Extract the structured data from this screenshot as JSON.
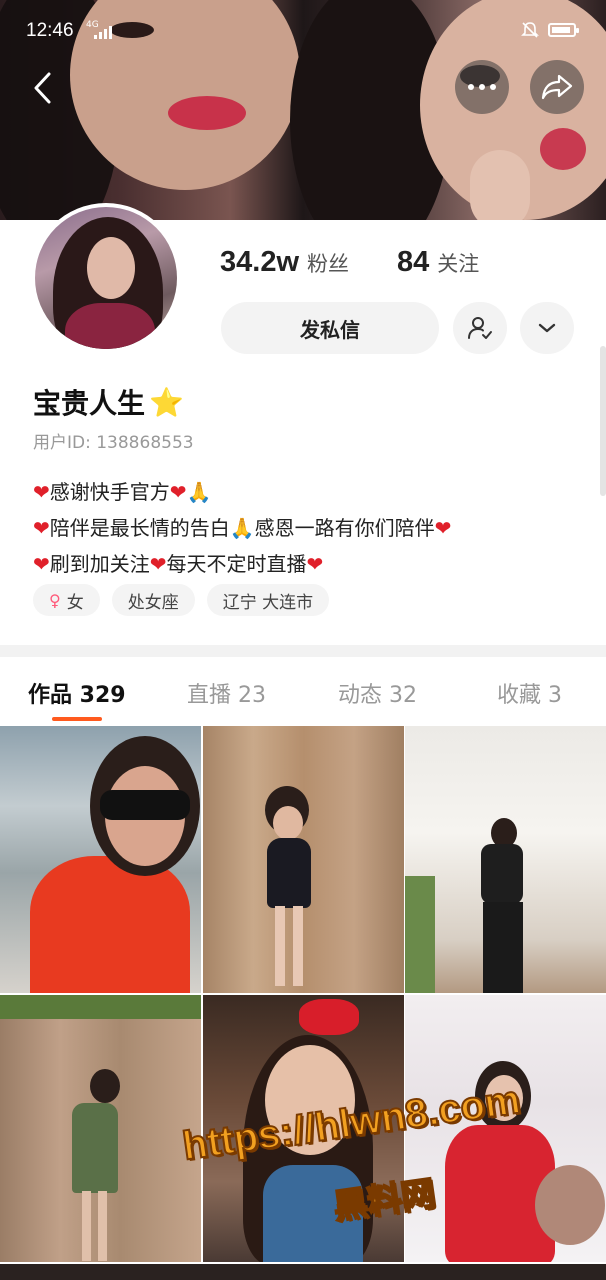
{
  "status_bar": {
    "time": "12:46",
    "network": "4G",
    "battery_level": 0.7
  },
  "header": {
    "back_icon": "chevron-left-icon",
    "more_icon": "more-dots-icon",
    "share_icon": "share-arrow-icon"
  },
  "profile": {
    "followers_count": "34.2w",
    "followers_label": "粉丝",
    "following_count": "84",
    "following_label": "关注",
    "message_button": "发私信",
    "name": "宝贵人生",
    "name_badge": "⭐",
    "user_id": "用户ID: 138868553",
    "bio_lines": [
      [
        "❤️",
        "感谢快手官方",
        "❤️",
        "🙏"
      ],
      [
        "❤️",
        "陪伴是最长情的告白",
        "🙏",
        "感恩一路有你们陪伴",
        "❤️"
      ],
      [
        "❤️",
        "刷到加关注",
        "❤️",
        "每天不定时直播",
        "❤️"
      ]
    ],
    "bio_text": {
      "l1a": "感谢快手官方",
      "l2a": "陪伴是最长情的告白",
      "l2b": "感恩一路有你们陪伴",
      "l3a": "刷到加关注",
      "l3b": "每天不定时直播"
    },
    "tags": {
      "gender": "女",
      "gender_symbol": "♀",
      "zodiac": "处女座",
      "location": "辽宁 大连市"
    }
  },
  "tabs": [
    {
      "label": "作品 329",
      "active": true
    },
    {
      "label": "直播 23",
      "active": false
    },
    {
      "label": "动态 32",
      "active": false
    },
    {
      "label": "收藏 3",
      "active": false
    }
  ],
  "tab_labels": {
    "works": "作品 329",
    "live": "直播 23",
    "moments": "动态 32",
    "favorites": "收藏 3"
  },
  "watermark": {
    "url": "https://hlwn8.com",
    "site": "黑料网"
  },
  "colors": {
    "accent": "#ff5a1e",
    "heart": "#e0202a",
    "tag_bg": "#f4f4f4",
    "button_bg": "#f3f3f3"
  }
}
